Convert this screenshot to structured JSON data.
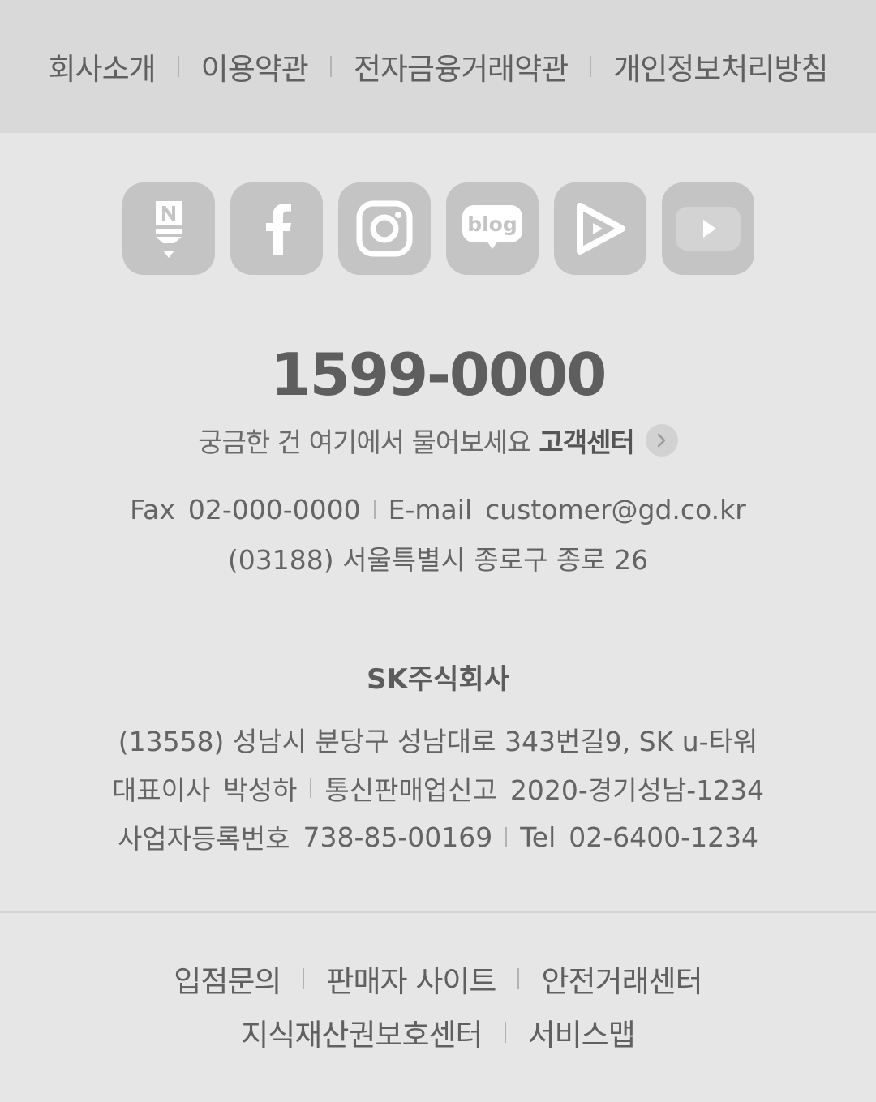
{
  "top_links": [
    "회사소개",
    "이용약관",
    "전자금융거래약관",
    "개인정보처리방침"
  ],
  "social": [
    {
      "name": "naver-post-icon"
    },
    {
      "name": "facebook-icon"
    },
    {
      "name": "instagram-icon"
    },
    {
      "name": "blog-icon",
      "text": "blog"
    },
    {
      "name": "play-icon"
    },
    {
      "name": "youtube-icon"
    }
  ],
  "contact": {
    "phone": "1599-0000",
    "question": "궁금한 건 여기에서 물어보세요",
    "cs_label": "고객센터",
    "fax_label": "Fax",
    "fax": "02-000-0000",
    "email_label": "E-mail",
    "email": "customer@gd.co.kr",
    "address": "(03188) 서울특별시 종로구 종로 26"
  },
  "company": {
    "name": "SK주식회사",
    "address": "(13558) 성남시 분당구 성남대로 343번길9, SK u-타워",
    "ceo_label": "대표이사",
    "ceo": "박성하",
    "mail_order_label": "통신판매업신고",
    "mail_order": "2020-경기성남-1234",
    "biz_no_label": "사업자등록번호",
    "biz_no": "738-85-00169",
    "tel_label": "Tel",
    "tel": "02-6400-1234"
  },
  "bottom_links": {
    "row1": [
      "입점문의",
      "판매자 사이트",
      "안전거래센터"
    ],
    "row2": [
      "지식재산권보호센터",
      "서비스맵"
    ]
  },
  "colors": {
    "icon_bg": "#c4c4c4",
    "icon_fg": "#ffffff",
    "top_bar_bg": "#d9d9d9",
    "page_bg": "#e6e6e6"
  }
}
